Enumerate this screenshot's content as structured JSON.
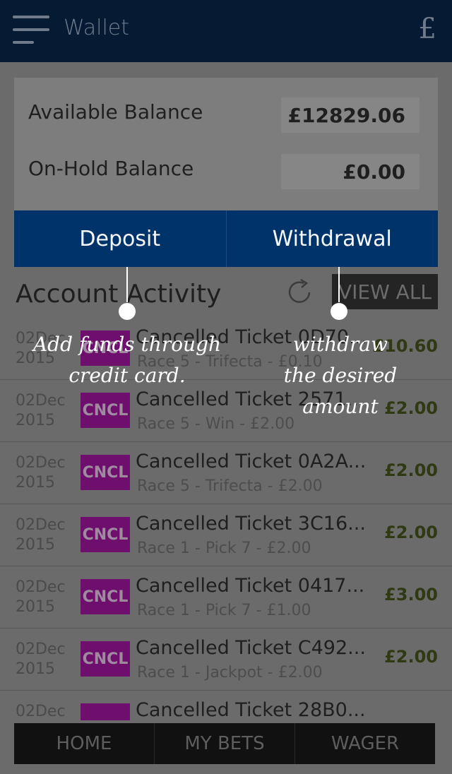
{
  "header": {
    "title": "Wallet",
    "currency_icon": "£"
  },
  "balances": [
    {
      "label": "Available Balance",
      "value": "£12829.06"
    },
    {
      "label": "On-Hold Balance",
      "value": "£0.00"
    }
  ],
  "actions": {
    "deposit": "Deposit",
    "withdrawal": "Withdrawal"
  },
  "activity": {
    "title": "Account Activity",
    "view_all": "VIEW ALL"
  },
  "tickets": [
    {
      "date_line1": "02Dec",
      "date_line2": "2015",
      "badge": "CNCL",
      "name": "Cancelled Ticket 0D70...",
      "detail": "Race 5 - Trifecta - £0.10",
      "amount": "£10.60"
    },
    {
      "date_line1": "02Dec",
      "date_line2": "2015",
      "badge": "CNCL",
      "name": "Cancelled Ticket 2571...",
      "detail": "Race 5 - Win - £2.00",
      "amount": "£2.00"
    },
    {
      "date_line1": "02Dec",
      "date_line2": "2015",
      "badge": "CNCL",
      "name": "Cancelled Ticket 0A2A...",
      "detail": "Race 5 - Trifecta - £2.00",
      "amount": "£2.00"
    },
    {
      "date_line1": "02Dec",
      "date_line2": "2015",
      "badge": "CNCL",
      "name": "Cancelled Ticket 3C16...",
      "detail": "Race 1 - Pick 7 - £2.00",
      "amount": "£2.00"
    },
    {
      "date_line1": "02Dec",
      "date_line2": "2015",
      "badge": "CNCL",
      "name": "Cancelled Ticket 0417...",
      "detail": "Race 1 - Pick 7 - £1.00",
      "amount": "£3.00"
    },
    {
      "date_line1": "02Dec",
      "date_line2": "2015",
      "badge": "CNCL",
      "name": "Cancelled Ticket C492...",
      "detail": "Race 1 - Jackpot - £2.00",
      "amount": "£2.00"
    },
    {
      "date_line1": "02Dec",
      "date_line2": "",
      "badge": "",
      "name": "Cancelled Ticket 28B0...",
      "detail": "",
      "amount": ""
    }
  ],
  "bottom_nav": {
    "home": "HOME",
    "my_bets": "MY BETS",
    "wager": "WAGER"
  },
  "annotations": {
    "deposit_tip": "Add funds through credit card.",
    "withdraw_tip": "withdraw the desired amount"
  }
}
